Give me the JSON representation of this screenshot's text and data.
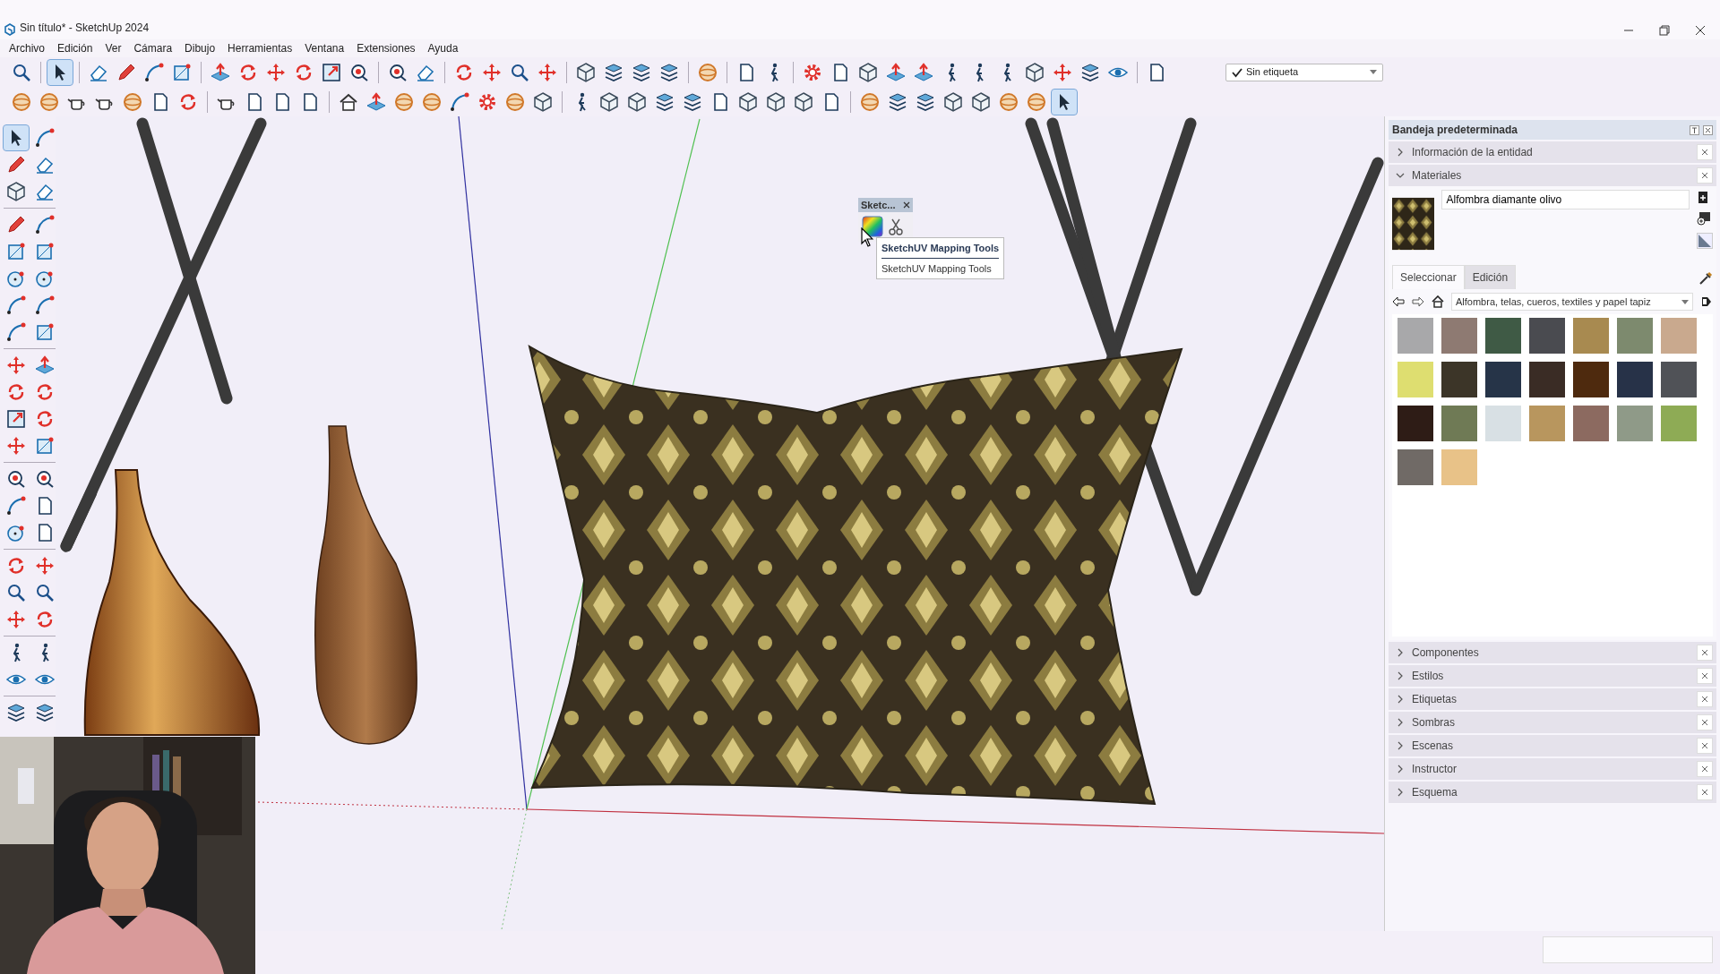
{
  "window": {
    "title": "Sin título* - SketchUp 2024"
  },
  "menu": [
    "Archivo",
    "Edición",
    "Ver",
    "Cámara",
    "Dibujo",
    "Herramientas",
    "Ventana",
    "Extensiones",
    "Ayuda"
  ],
  "select_tool": {
    "selected": true
  },
  "tag_dropdown": {
    "value": "Sin etiqueta",
    "checked": true
  },
  "floating_toolbar": {
    "title": "Sketc...",
    "tooltip": {
      "title": "SketchUV Mapping Tools",
      "description": "SketchUV Mapping Tools"
    }
  },
  "tray": {
    "title": "Bandeja predeterminada",
    "panels": [
      {
        "label": "Información de la entidad",
        "expanded": false
      },
      {
        "label": "Materiales",
        "expanded": true,
        "material_name": "Alfombra diamante olivo",
        "tabs": [
          {
            "label": "Seleccionar",
            "selected": true
          },
          {
            "label": "Edición",
            "selected": false
          }
        ],
        "library": "Alfombra, telas, cueros, textiles y papel tapiz",
        "swatches": [
          {
            "color": "#a8a8aa"
          },
          {
            "color": "#8e7a72"
          },
          {
            "color": "#3f5a45"
          },
          {
            "color": "#4a4b50"
          },
          {
            "color": "#a88a50"
          },
          {
            "color": "#7d8a6e"
          },
          {
            "color": "#c9a98e"
          },
          {
            "color": "#dede70"
          },
          {
            "color": "#3c3528"
          },
          {
            "color": "#263448"
          },
          {
            "color": "#3a2c25"
          },
          {
            "color": "#4e2a0e"
          },
          {
            "color": "#273248"
          },
          {
            "color": "#505257"
          },
          {
            "color": "#2e1c16"
          },
          {
            "color": "#6f7a55"
          },
          {
            "color": "#d8e0e4"
          },
          {
            "color": "#b8965e"
          },
          {
            "color": "#8c6a60"
          },
          {
            "color": "#8f9a88"
          },
          {
            "color": "#8eab55"
          },
          {
            "color": "#706a66"
          },
          {
            "color": "#e8c288"
          }
        ]
      },
      {
        "label": "Componentes",
        "expanded": false
      },
      {
        "label": "Estilos",
        "expanded": false
      },
      {
        "label": "Etiquetas",
        "expanded": false
      },
      {
        "label": "Sombras",
        "expanded": false
      },
      {
        "label": "Escenas",
        "expanded": false
      },
      {
        "label": "Instructor",
        "expanded": false
      },
      {
        "label": "Esquema",
        "expanded": false
      }
    ]
  }
}
